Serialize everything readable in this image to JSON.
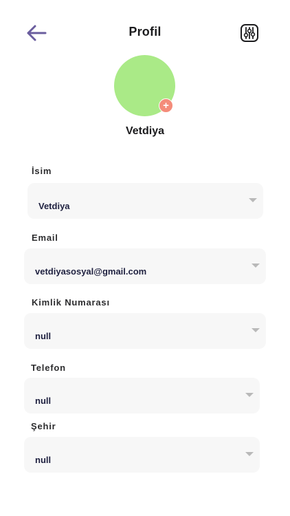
{
  "header": {
    "title": "Profil",
    "back_icon": "arrow-left-icon",
    "settings_icon": "sliders-icon"
  },
  "profile": {
    "name": "Vetdiya",
    "avatar_color": "#aaea87",
    "add_badge_symbol": "+",
    "add_badge_color": "#f48c7a"
  },
  "colors": {
    "accent": "#6a5d9e",
    "field_bg": "#f7f7f7"
  },
  "fields": [
    {
      "label": "İsim",
      "value": "Vetdiya"
    },
    {
      "label": "Email",
      "value": "vetdiyasosyal@gmail.com"
    },
    {
      "label": "Kimlik Numarası",
      "value": "null"
    },
    {
      "label": "Telefon",
      "value": "null"
    },
    {
      "label": "Şehir",
      "value": "null"
    }
  ]
}
